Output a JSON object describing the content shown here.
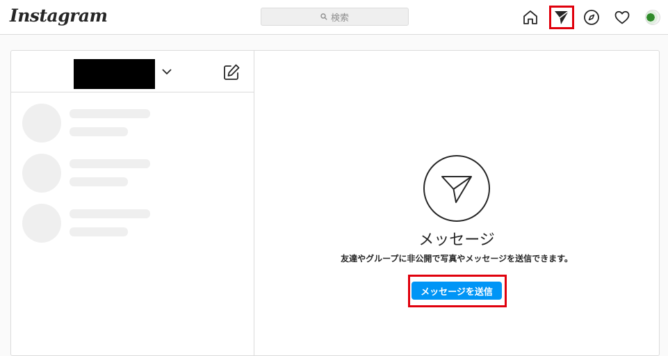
{
  "app": {
    "logo": "Instagram"
  },
  "search": {
    "placeholder": "検索"
  },
  "nav": {
    "icons": [
      "home-icon",
      "direct-message-icon",
      "explore-icon",
      "activity-heart-icon",
      "profile-avatar"
    ]
  },
  "colors": {
    "primary_button": "#0095f6",
    "highlight": "#e0000c",
    "skeleton": "#efefef"
  },
  "inbox": {
    "icons": [
      "chevron-down-icon",
      "new-message-icon"
    ],
    "skeleton_rows": 3
  },
  "main": {
    "title": "メッセージ",
    "subtitle": "友達やグループに非公開で写真やメッセージを送信できます。",
    "send_button": "メッセージを送信"
  }
}
